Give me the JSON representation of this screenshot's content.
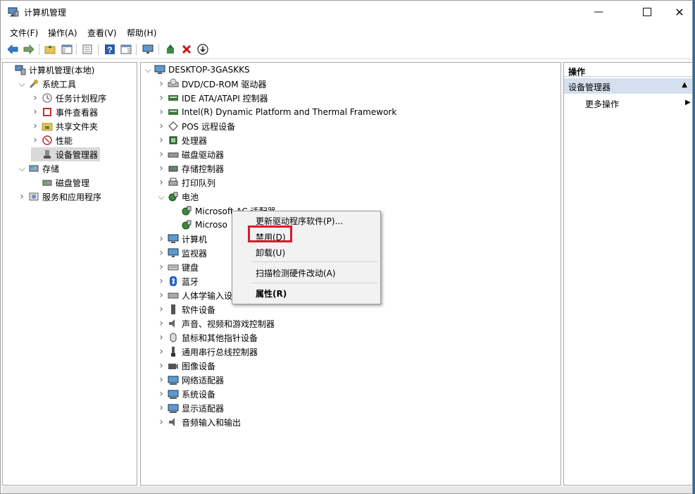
{
  "window": {
    "title": "计算机管理"
  },
  "menu": [
    "文件(F)",
    "操作(A)",
    "查看(V)",
    "帮助(H)"
  ],
  "toolbar_icons": [
    "back-arrow-icon",
    "forward-arrow-icon",
    "up-folder-icon",
    "show-hide-tree-icon",
    "properties-icon",
    "help-icon",
    "show-action-pane-icon",
    "monitor-icon",
    "update-driver-icon",
    "uninstall-icon",
    "disable-icon"
  ],
  "left_tree": [
    {
      "label": "计算机管理(本地)",
      "icon": "computer-management-icon",
      "level": 0,
      "chev": ""
    },
    {
      "label": "系统工具",
      "icon": "tools-icon",
      "level": 1,
      "chev": "v"
    },
    {
      "label": "任务计划程序",
      "icon": "clock-icon",
      "level": 2,
      "chev": ">"
    },
    {
      "label": "事件查看器",
      "icon": "event-viewer-icon",
      "level": 2,
      "chev": ">"
    },
    {
      "label": "共享文件夹",
      "icon": "shared-folder-icon",
      "level": 2,
      "chev": ">"
    },
    {
      "label": "性能",
      "icon": "performance-icon",
      "level": 2,
      "chev": ">"
    },
    {
      "label": "设备管理器",
      "icon": "device-manager-icon",
      "level": 2,
      "chev": "",
      "selected": true
    },
    {
      "label": "存储",
      "icon": "storage-icon",
      "level": 1,
      "chev": "v"
    },
    {
      "label": "磁盘管理",
      "icon": "disk-management-icon",
      "level": 2,
      "chev": ""
    },
    {
      "label": "服务和应用程序",
      "icon": "services-icon",
      "level": 1,
      "chev": ">"
    }
  ],
  "device_tree": [
    {
      "label": "DESKTOP-3GASKKS",
      "icon": "computer-icon",
      "level": 0,
      "chev": "v"
    },
    {
      "label": "DVD/CD-ROM 驱动器",
      "icon": "dvd-icon",
      "level": 1,
      "chev": ">"
    },
    {
      "label": "IDE ATA/ATAPI 控制器",
      "icon": "ide-controller-icon",
      "level": 1,
      "chev": ">"
    },
    {
      "label": "Intel(R) Dynamic Platform and Thermal Framework",
      "icon": "intel-device-icon",
      "level": 1,
      "chev": ">"
    },
    {
      "label": "POS 远程设备",
      "icon": "pos-device-icon",
      "level": 1,
      "chev": ">"
    },
    {
      "label": "处理器",
      "icon": "processor-icon",
      "level": 1,
      "chev": ">"
    },
    {
      "label": "磁盘驱动器",
      "icon": "disk-drive-icon",
      "level": 1,
      "chev": ">"
    },
    {
      "label": "存储控制器",
      "icon": "storage-controller-icon",
      "level": 1,
      "chev": ">"
    },
    {
      "label": "打印队列",
      "icon": "printer-icon",
      "level": 1,
      "chev": ">"
    },
    {
      "label": "电池",
      "icon": "battery-icon",
      "level": 1,
      "chev": "v"
    },
    {
      "label": "Microsoft AC 适配器",
      "icon": "battery-device-icon",
      "level": 2,
      "chev": ""
    },
    {
      "label": "Microso",
      "icon": "battery-device-icon",
      "level": 2,
      "chev": ""
    },
    {
      "label": "计算机",
      "icon": "computer-icon",
      "level": 1,
      "chev": ">"
    },
    {
      "label": "监视器",
      "icon": "monitor-icon",
      "level": 1,
      "chev": ">"
    },
    {
      "label": "键盘",
      "icon": "keyboard-icon",
      "level": 1,
      "chev": ">"
    },
    {
      "label": "蓝牙",
      "icon": "bluetooth-icon",
      "level": 1,
      "chev": ">"
    },
    {
      "label": "人体学输入设",
      "icon": "hid-icon",
      "level": 1,
      "chev": ">"
    },
    {
      "label": "软件设备",
      "icon": "software-device-icon",
      "level": 1,
      "chev": ">"
    },
    {
      "label": "声音、视频和游戏控制器",
      "icon": "sound-icon",
      "level": 1,
      "chev": ">"
    },
    {
      "label": "鼠标和其他指针设备",
      "icon": "mouse-icon",
      "level": 1,
      "chev": ">"
    },
    {
      "label": "通用串行总线控制器",
      "icon": "usb-icon",
      "level": 1,
      "chev": ">"
    },
    {
      "label": "图像设备",
      "icon": "camera-icon",
      "level": 1,
      "chev": ">"
    },
    {
      "label": "网络适配器",
      "icon": "network-adapter-icon",
      "level": 1,
      "chev": ">"
    },
    {
      "label": "系统设备",
      "icon": "system-device-icon",
      "level": 1,
      "chev": ">"
    },
    {
      "label": "显示适配器",
      "icon": "display-adapter-icon",
      "level": 1,
      "chev": ">"
    },
    {
      "label": "音频输入和输出",
      "icon": "audio-io-icon",
      "level": 1,
      "chev": ">"
    }
  ],
  "actions": {
    "header": "操作",
    "section": "设备管理器",
    "more": "更多操作"
  },
  "context_menu": {
    "update": "更新驱动程序软件(P)...",
    "disable": "禁用(D)",
    "uninstall": "卸载(U)",
    "scan": "扫描检测硬件改动(A)",
    "properties": "属性(R)"
  },
  "colors": {
    "highlight_box": "#e0182b",
    "selection": "#d9d9d9",
    "action_section": "#d4e0ee",
    "desktop": "#2a6ea8"
  }
}
